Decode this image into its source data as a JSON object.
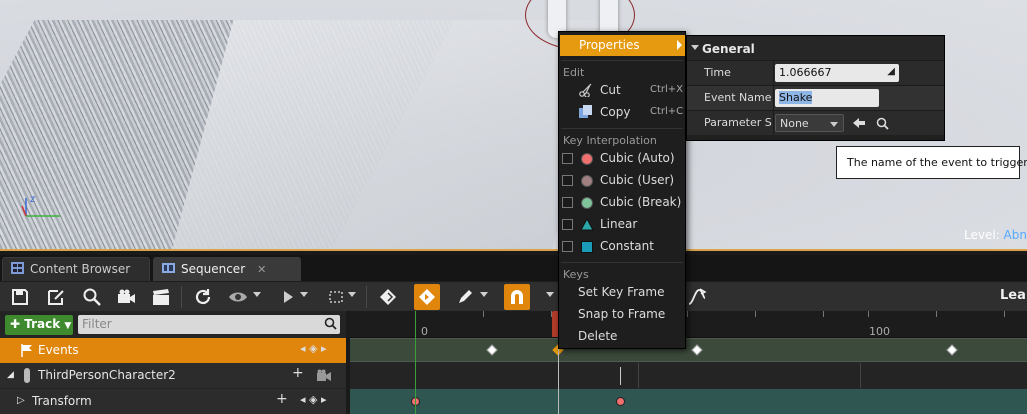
{
  "viewport": {
    "level_prefix": "Level:",
    "level_value": "Abn",
    "gizmo_z": "z"
  },
  "tabs": [
    {
      "label": "Content Browser",
      "icon": "grid-icon"
    },
    {
      "label": "Sequencer",
      "icon": "film-icon",
      "close": "✕"
    }
  ],
  "toolbar": {
    "right_label": "Lea"
  },
  "tracklist": {
    "add_track_label": "Track",
    "filter_placeholder": "Filter",
    "rows": [
      {
        "label": "Events"
      },
      {
        "label": "ThirdPersonCharacter2"
      },
      {
        "label": "Transform"
      }
    ]
  },
  "timeline": {
    "ruler_labels": [
      "0",
      "100"
    ]
  },
  "context_menu": {
    "properties_label": "Properties",
    "edit_section": "Edit",
    "cut_label": "Cut",
    "cut_shortcut": "Ctrl+X",
    "copy_label": "Copy",
    "copy_shortcut": "Ctrl+C",
    "interp_section": "Key Interpolation",
    "interp_items": [
      {
        "label": "Cubic (Auto)",
        "color": "#f07070"
      },
      {
        "label": "Cubic (User)",
        "color": "#a08080"
      },
      {
        "label": "Cubic (Break)",
        "color": "#7fc49a"
      },
      {
        "label": "Linear",
        "color": "#2aa6a6"
      },
      {
        "label": "Constant",
        "color": "#1a9bb8"
      }
    ],
    "keys_section": "Keys",
    "set_key_frame": "Set Key Frame",
    "snap_to_frame": "Snap to Frame",
    "delete": "Delete"
  },
  "properties": {
    "section": "General",
    "time_label": "Time",
    "time_value": "1.066667",
    "event_name_label": "Event Name",
    "event_name_value": "Shake",
    "parameter_label": "Parameter S",
    "parameter_value": "None"
  },
  "tooltip": "The name of the event to trigger",
  "colors": {
    "accent_orange": "#e0860d",
    "track_green": "#3f8a2e"
  }
}
